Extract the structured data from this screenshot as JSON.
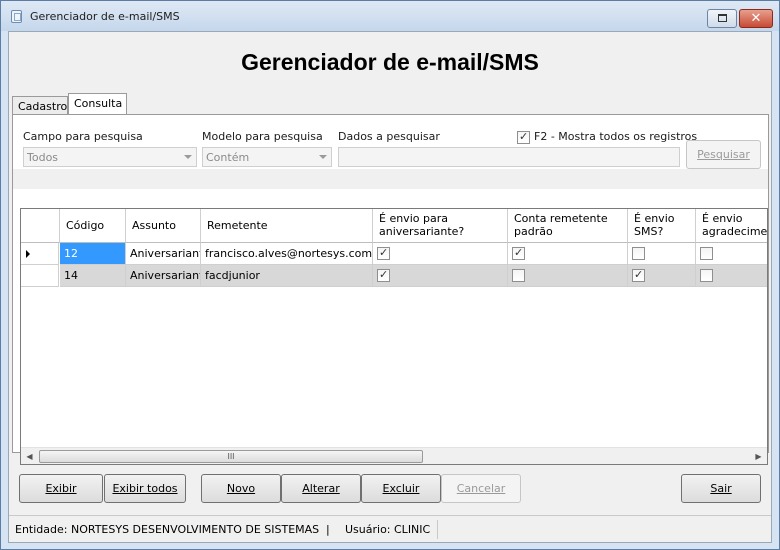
{
  "window": {
    "title": "Gerenciador de e-mail/SMS",
    "restore_icon": "restore-icon",
    "close_glyph": "✕"
  },
  "header": {
    "title": "Gerenciador de e-mail/SMS"
  },
  "tabs": [
    {
      "label": "Cadastro"
    },
    {
      "label": "Consulta",
      "active": true
    }
  ],
  "search": {
    "field_label": "Campo para pesquisa",
    "field_value": "Todos",
    "model_label": "Modelo para pesquisa",
    "model_value": "Contém",
    "data_label": "Dados a pesquisar",
    "data_value": "",
    "show_all_label": "F2 - Mostra todos os registros",
    "show_all_checked": true,
    "search_button": "Pesquisar"
  },
  "grid": {
    "columns": [
      "Código",
      "Assunto",
      "Remetente",
      "É envio para aniversariante?",
      "Conta remetente padrão",
      "É envio SMS?",
      "É envio agradecimento"
    ],
    "rows": [
      {
        "codigo": "12",
        "assunto": "Aniversariante",
        "remetente": "francisco.alves@nortesys.com.br",
        "aniversariante": true,
        "padrao": true,
        "sms": false,
        "agradecimento": false
      },
      {
        "codigo": "14",
        "assunto": "Aniversariante",
        "remetente": "facdjunior",
        "aniversariante": true,
        "padrao": false,
        "sms": true,
        "agradecimento": false
      }
    ],
    "scroll_grip": "III"
  },
  "buttons": {
    "exibir": "Exibir",
    "exibir_todos": "Exibir todos",
    "novo": "Novo",
    "alterar": "Alterar",
    "excluir": "Excluir",
    "cancelar": "Cancelar",
    "sair": "Sair"
  },
  "status": {
    "entidade": "Entidade: NORTESYS DESENVOLVIMENTO DE SISTEMAS",
    "divider": "|",
    "usuario": "Usuário: CLINIC"
  }
}
